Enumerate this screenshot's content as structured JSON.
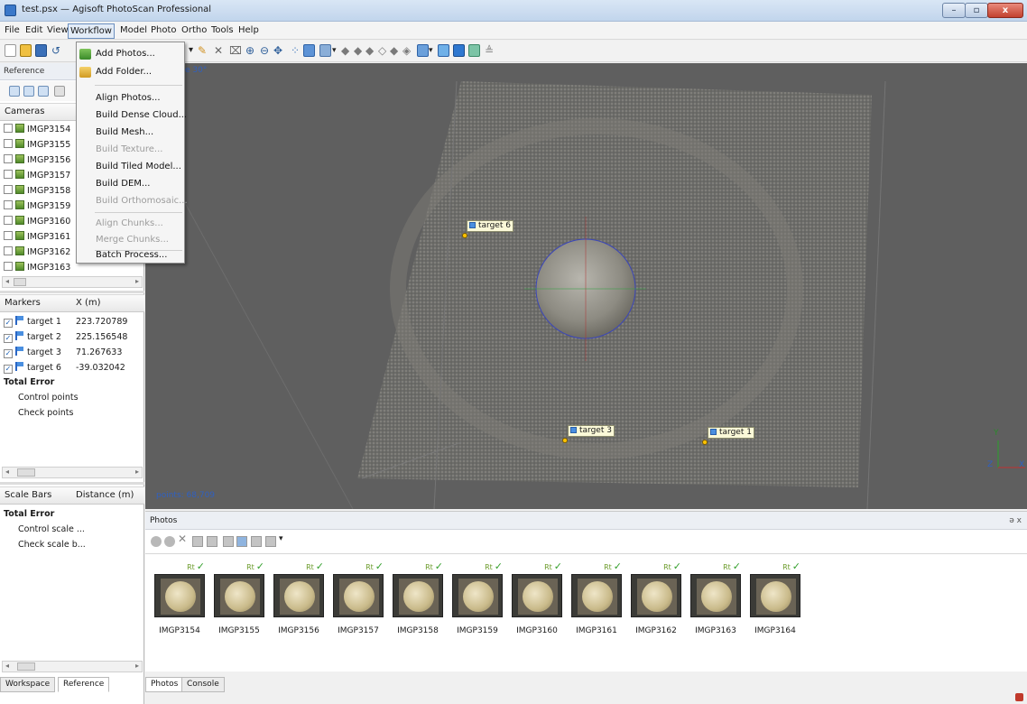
{
  "window": {
    "title": "test.psx — Agisoft PhotoScan Professional",
    "controls": {
      "minimize": "–",
      "maximize": "▫",
      "close": "x"
    }
  },
  "menubar": {
    "items": [
      "File",
      "Edit",
      "View",
      "Workflow",
      "Model",
      "Photo",
      "Ortho",
      "Tools",
      "Help"
    ],
    "active": "Workflow"
  },
  "workflow_menu": {
    "items": [
      {
        "label": "Add Photos...",
        "enabled": true,
        "icon": "add-photos-icon"
      },
      {
        "label": "Add Folder...",
        "enabled": true,
        "icon": "add-folder-icon"
      },
      {
        "label": "Align Photos...",
        "enabled": true
      },
      {
        "label": "Build Dense Cloud...",
        "enabled": true
      },
      {
        "label": "Build Mesh...",
        "enabled": true
      },
      {
        "label": "Build Texture...",
        "enabled": false
      },
      {
        "label": "Build Tiled Model...",
        "enabled": true
      },
      {
        "label": "Build DEM...",
        "enabled": true
      },
      {
        "label": "Build Orthomosaic...",
        "enabled": false
      },
      {
        "label": "Align Chunks...",
        "enabled": false
      },
      {
        "label": "Merge Chunks...",
        "enabled": false
      },
      {
        "label": "Batch Process...",
        "enabled": true
      }
    ]
  },
  "reference_panel": {
    "title": "Reference",
    "cameras": {
      "header": "Cameras",
      "items": [
        "IMGP3154",
        "IMGP3155",
        "IMGP3156",
        "IMGP3157",
        "IMGP3158",
        "IMGP3159",
        "IMGP3160",
        "IMGP3161",
        "IMGP3162",
        "IMGP3163"
      ]
    },
    "markers": {
      "header": "Markers",
      "col_x": "X (m)",
      "items": [
        {
          "name": "target 1",
          "x": "223.720789"
        },
        {
          "name": "target 2",
          "x": "225.156548"
        },
        {
          "name": "target 3",
          "x": "71.267633"
        },
        {
          "name": "target 6",
          "x": "-39.032042"
        }
      ],
      "total_error": "Total Error",
      "control_points": "Control points",
      "check_points": "Check points"
    },
    "scale_bars": {
      "header": "Scale Bars",
      "col_distance": "Distance (m)",
      "total_error": "Total Error",
      "control_scale": "Control scale ...",
      "check_scale": "Check scale b..."
    },
    "tabs": [
      "Workspace",
      "Reference"
    ],
    "active_tab": "Reference",
    "scroll_mark": "III"
  },
  "viewport": {
    "perspective_label": "e 30°",
    "points_label": "points: 68,709",
    "markers": [
      {
        "label": "target 6"
      },
      {
        "label": "target 3"
      },
      {
        "label": "target 1"
      }
    ],
    "axes": {
      "y": "Y",
      "z": "Z",
      "x": "X"
    }
  },
  "photos_panel": {
    "title": "Photos",
    "dock_controls": "ə x",
    "photos": [
      "IMGP3154",
      "IMGP3155",
      "IMGP3156",
      "IMGP3157",
      "IMGP3158",
      "IMGP3159",
      "IMGP3160",
      "IMGP3161",
      "IMGP3162",
      "IMGP3163",
      "IMGP3164"
    ],
    "tabs": [
      "Photos",
      "Console"
    ],
    "active_tab": "Photos"
  },
  "colors": {
    "viewport_bg": "#5f5f5f",
    "marker_bg": "#fbf9d8",
    "accent": "#3a78c9",
    "check_green": "#34a02c"
  }
}
